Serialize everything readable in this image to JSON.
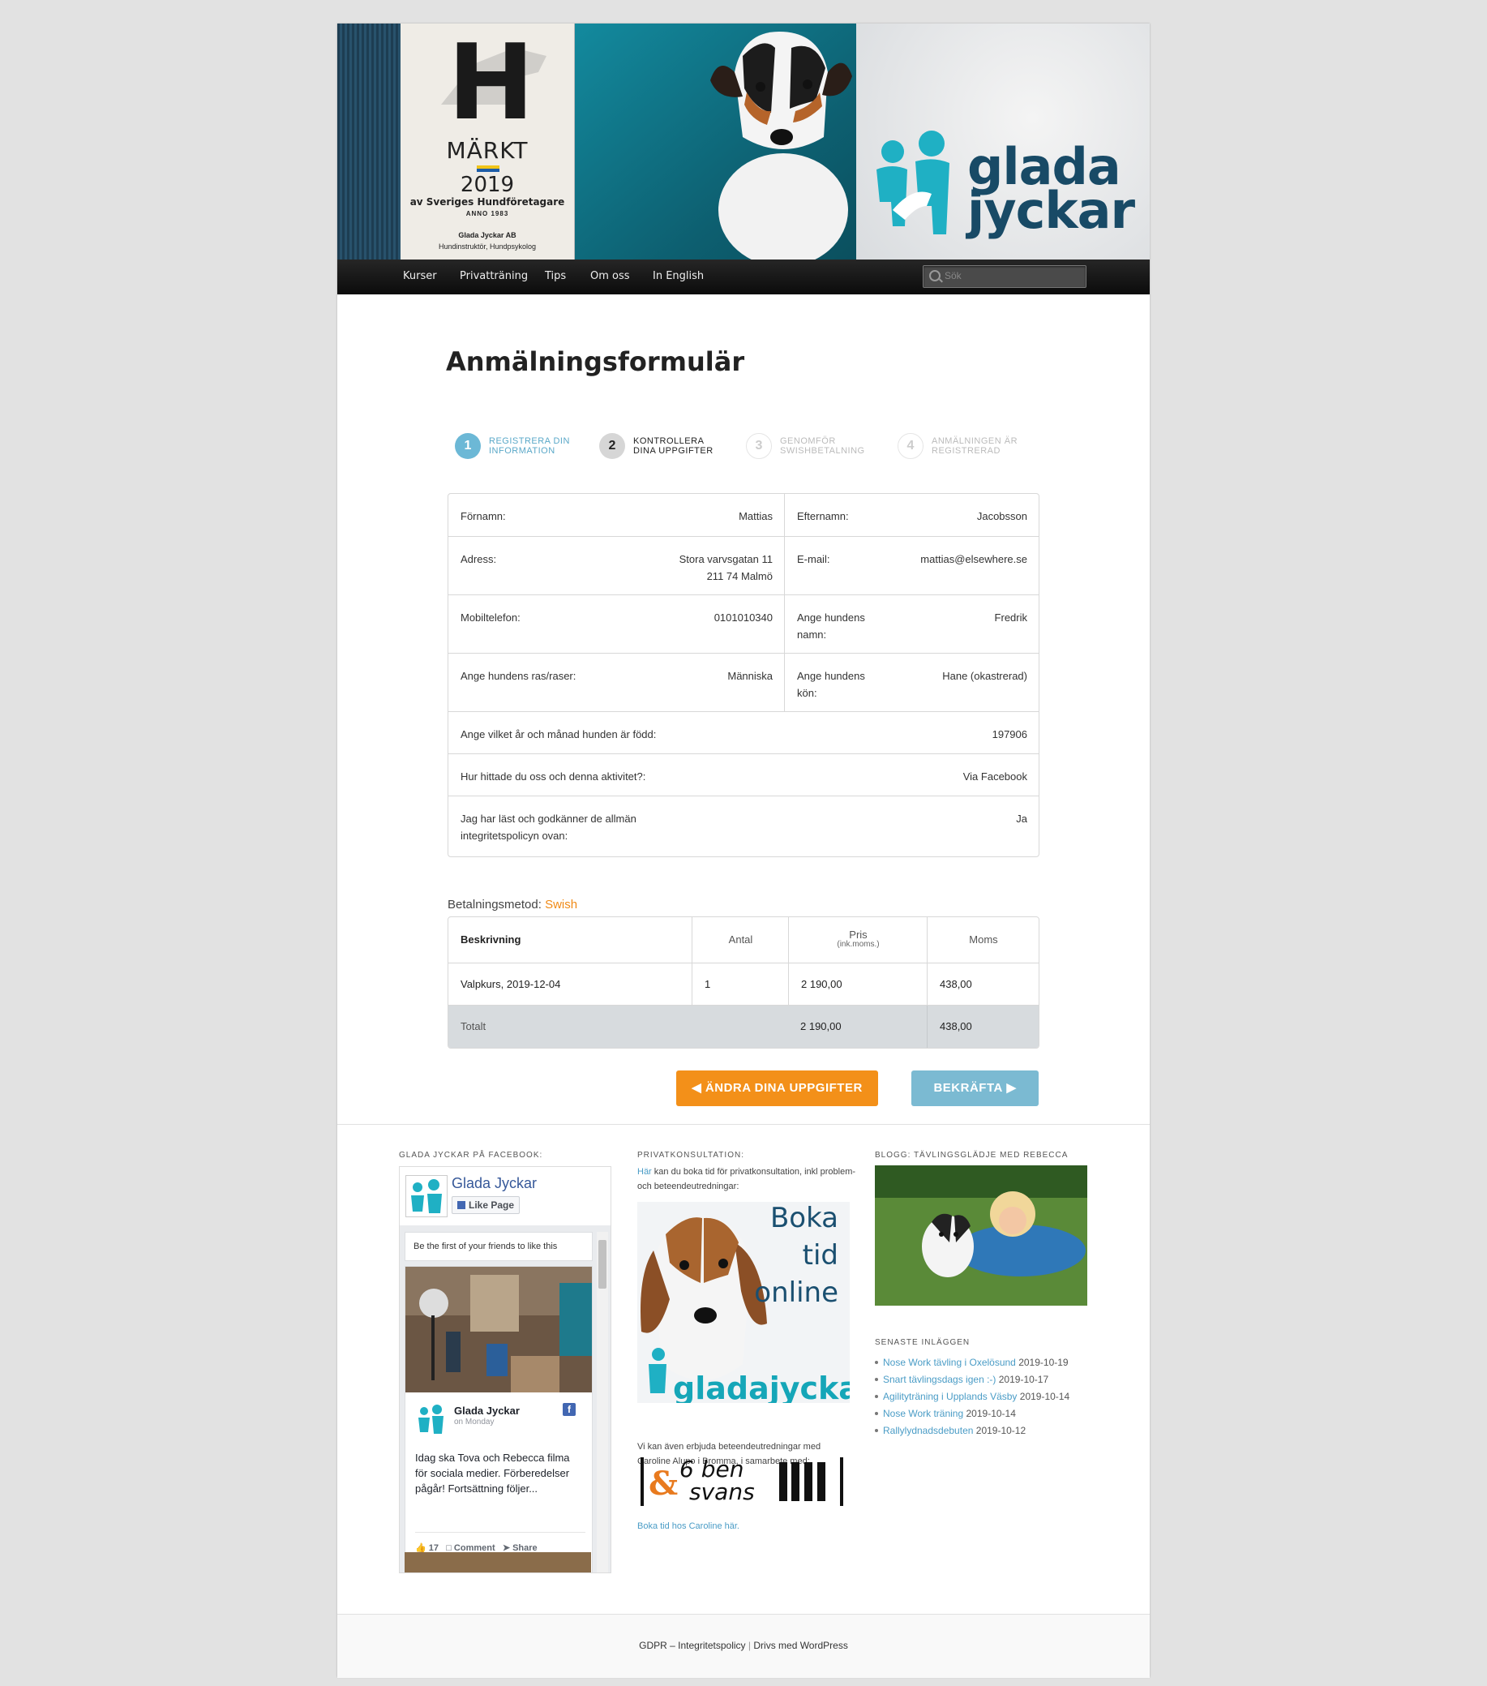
{
  "header": {
    "badge": {
      "line1": "H",
      "line2": "MÄRKT",
      "year": "2019",
      "by": "av Sveriges Hundföretagare",
      "anno": "ANNO 1983",
      "company": "Glada Jyckar AB",
      "sub": "Hundinstruktör, Hundpsykolog"
    },
    "logo_text": [
      "glada",
      "jyckar"
    ]
  },
  "nav": {
    "items": [
      "Kurser",
      "Privatträning",
      "Tips",
      "Om oss",
      "In English"
    ],
    "search_placeholder": "Sök"
  },
  "page": {
    "title": "Anmälningsformulär"
  },
  "steps": [
    {
      "num": "1",
      "label": "REGISTRERA DIN INFORMATION"
    },
    {
      "num": "2",
      "label": "KONTROLLERA DINA UPPGIFTER"
    },
    {
      "num": "3",
      "label": "GENOMFÖR SWISHBETALNING"
    },
    {
      "num": "4",
      "label": "ANMÄLNINGEN ÄR REGISTRERAD"
    }
  ],
  "info": {
    "fornamn": {
      "label": "Förnamn:",
      "value": "Mattias"
    },
    "efternamn": {
      "label": "Efternamn:",
      "value": "Jacobsson"
    },
    "adress": {
      "label": "Adress:",
      "value1": "Stora varvsgatan 11",
      "value2": "211 74 Malmö"
    },
    "email": {
      "label": "E-mail:",
      "value": "mattias@elsewhere.se"
    },
    "mobil": {
      "label": "Mobiltelefon:",
      "value": "0101010340"
    },
    "hundnamn": {
      "label": "Ange hundens namn:",
      "value": "Fredrik"
    },
    "ras": {
      "label": "Ange hundens ras/raser:",
      "value": "Människa"
    },
    "kon": {
      "label": "Ange hundens kön:",
      "value": "Hane (okastrerad)"
    },
    "fodd": {
      "label": "Ange vilket år och månad hunden är född:",
      "value": "197906"
    },
    "hittade": {
      "label": "Hur hittade du oss och denna aktivitet?:",
      "value": "Via Facebook"
    },
    "policy": {
      "label": "Jag har läst och godkänner de allmän integritetspolicyn ovan:",
      "value": "Ja"
    }
  },
  "payment": {
    "label": "Betalningsmetod:",
    "method": "Swish"
  },
  "order": {
    "headers": {
      "desc": "Beskrivning",
      "qty": "Antal",
      "price": "Pris",
      "price_sub": "(ink.moms.)",
      "vat": "Moms"
    },
    "row": {
      "desc": "Valpkurs,  2019-12-04",
      "qty": "1",
      "price": "2 190,00",
      "vat": "438,00"
    },
    "total": {
      "label": "Totalt",
      "price": "2 190,00",
      "vat": "438,00"
    }
  },
  "buttons": {
    "edit": "ÄNDRA DINA UPPGIFTER",
    "confirm": "BEKRÄFTA"
  },
  "widgets": {
    "facebook": {
      "title": "GLADA JYCKAR PÅ FACEBOOK:",
      "page_name": "Glada Jyckar",
      "like": "Like Page",
      "first": "Be the first of your friends to like this",
      "post_name": "Glada Jyckar",
      "post_date": "on Monday",
      "post_text": "Idag ska Tova och Rebecca filma för sociala medier. Förberedelser pågår! Fortsättning följer...",
      "likes": "17",
      "comment": "Comment",
      "share": "Share"
    },
    "privat": {
      "title": "PRIVATKONSULTATION:",
      "link": "Här",
      "text": " kan du boka tid för privatkonsultation, inkl problem- och beteendeutredningar:",
      "boka": [
        "Boka",
        "tid",
        "online"
      ],
      "boka_logo": "gladajyckar",
      "text2": "Vi kan även erbjuda beteendeutredningar med Caroline Alupo i Bromma, i samarbete med:",
      "logo_6ben": "6 ben",
      "logo_svans": "svans",
      "link2": "Boka tid hos Caroline här."
    },
    "blogg": {
      "title": "BLOGG: TÄVLINGSGLÄDJE MED REBECCA",
      "recent_title": "SENASTE INLÄGGEN",
      "posts": [
        {
          "title": "Nose Work tävling i Oxelösund",
          "date": "2019-10-19"
        },
        {
          "title": "Snart tävlingsdags igen :-)",
          "date": "2019-10-17"
        },
        {
          "title": "Agilityträning i Upplands Väsby",
          "date": "2019-10-14"
        },
        {
          "title": "Nose Work träning",
          "date": "2019-10-14"
        },
        {
          "title": "Rallylydnadsdebuten",
          "date": "2019-10-12"
        }
      ]
    }
  },
  "footer": {
    "gdpr": "GDPR – Integritetspolicy",
    "sep": "|",
    "wp": "Drivs med WordPress"
  },
  "colors": {
    "accent_orange": "#f39019",
    "accent_blue": "#7bbad2",
    "link": "#4a9cc6",
    "brand_teal": "#15a6b8"
  }
}
